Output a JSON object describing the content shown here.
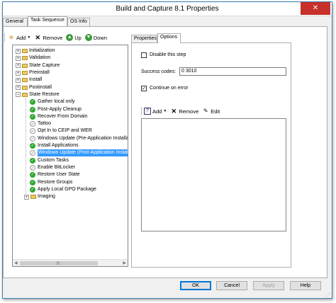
{
  "window": {
    "title": "Build and Capture 8.1 Properties",
    "close_glyph": "✕"
  },
  "tabs": [
    {
      "label": "General"
    },
    {
      "label": "Task Sequence"
    },
    {
      "label": "OS Info"
    }
  ],
  "toolbar": {
    "add_label": "Add",
    "remove_label": "Remove",
    "up_label": "Up",
    "down_label": "Down"
  },
  "tree": {
    "items": [
      {
        "label": "Initialization",
        "kind": "group",
        "level": 0
      },
      {
        "label": "Validation",
        "kind": "group",
        "level": 0
      },
      {
        "label": "State Capture",
        "kind": "group",
        "level": 0
      },
      {
        "label": "Preinstall",
        "kind": "group",
        "level": 0
      },
      {
        "label": "Install",
        "kind": "group",
        "level": 0
      },
      {
        "label": "Postinstall",
        "kind": "group",
        "level": 0
      },
      {
        "label": "State Restore",
        "kind": "group-open",
        "level": 0
      },
      {
        "label": "Gather local only",
        "kind": "step",
        "level": 1
      },
      {
        "label": "Post-Apply Cleanup",
        "kind": "step",
        "level": 1
      },
      {
        "label": "Recover From Domain",
        "kind": "step",
        "level": 1
      },
      {
        "label": "Tattoo",
        "kind": "step-grey",
        "level": 1
      },
      {
        "label": "Opt In to CEIP and WER",
        "kind": "step-grey",
        "level": 1
      },
      {
        "label": "Windows Update (Pre-Application Installa",
        "kind": "step-grey",
        "level": 1
      },
      {
        "label": "Install Applications",
        "kind": "step",
        "level": 1
      },
      {
        "label": "Windows Update (Post-Application Install",
        "kind": "step-grey",
        "level": 1,
        "selected": true
      },
      {
        "label": "Custom Tasks",
        "kind": "step",
        "level": 1
      },
      {
        "label": "Enable BitLocker",
        "kind": "step-grey",
        "level": 1
      },
      {
        "label": "Restore User State",
        "kind": "step",
        "level": 1
      },
      {
        "label": "Restore Groups",
        "kind": "step",
        "level": 1
      },
      {
        "label": "Apply Local GPO Package",
        "kind": "step",
        "level": 1
      },
      {
        "label": "Imaging",
        "kind": "group",
        "level": 1
      }
    ]
  },
  "right_tabs": [
    {
      "label": "Properties"
    },
    {
      "label": "Options"
    }
  ],
  "options": {
    "disable_label": "Disable this step",
    "disable_checked": false,
    "success_codes_label": "Success codes:",
    "success_codes_value": "0 3010",
    "continue_label": "Continue on error",
    "continue_checked": true,
    "cond_add_label": "Add",
    "cond_remove_label": "Remove",
    "cond_edit_label": "Edit"
  },
  "buttons": {
    "ok": "OK",
    "cancel": "Cancel",
    "apply": "Apply",
    "help": "Help"
  },
  "colors": {
    "selection": "#3399ff",
    "check_green": "#2ea82e",
    "close_red": "#c7302b",
    "accent": "#0078d7"
  }
}
